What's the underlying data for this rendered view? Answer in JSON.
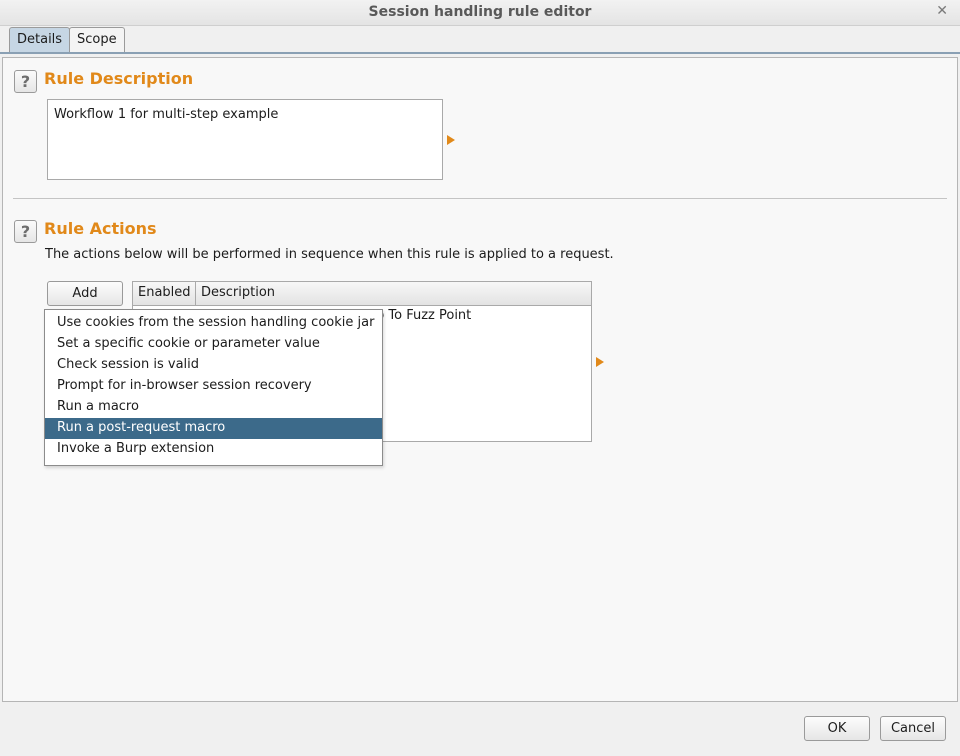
{
  "window": {
    "title": "Session handling rule editor",
    "close_glyph": "✕"
  },
  "tabs": [
    {
      "label": "Details",
      "active": true
    },
    {
      "label": "Scope",
      "active": false
    }
  ],
  "rule_description": {
    "help_glyph": "?",
    "heading": "Rule Description",
    "text": "Workflow 1 for multi-step example"
  },
  "rule_actions": {
    "help_glyph": "?",
    "heading": "Rule Actions",
    "info": "The actions below will be performed in sequence when this rule is applied to a request.",
    "add_label": "Add",
    "table": {
      "columns": [
        "Enabled",
        "Description"
      ],
      "rows": [
        {
          "description_visible": "p To Fuzz Point"
        }
      ]
    }
  },
  "add_menu": {
    "items": [
      {
        "label": "Use cookies from the session handling cookie jar",
        "selected": false
      },
      {
        "label": "Set a specific cookie or parameter value",
        "selected": false
      },
      {
        "label": "Check session is valid",
        "selected": false
      },
      {
        "label": "Prompt for in-browser session recovery",
        "selected": false
      },
      {
        "label": "Run a macro",
        "selected": false
      },
      {
        "label": "Run a post-request macro",
        "selected": true
      },
      {
        "label": "Invoke a Burp extension",
        "selected": false
      }
    ]
  },
  "footer": {
    "ok_label": "OK",
    "cancel_label": "Cancel"
  },
  "colors": {
    "accent": "#e1891a",
    "tab_active": "#c6d6e4",
    "menu_selected": "#3c6a8a"
  },
  "icons": [
    "help-icon",
    "close-icon",
    "expand-arrow-icon"
  ]
}
